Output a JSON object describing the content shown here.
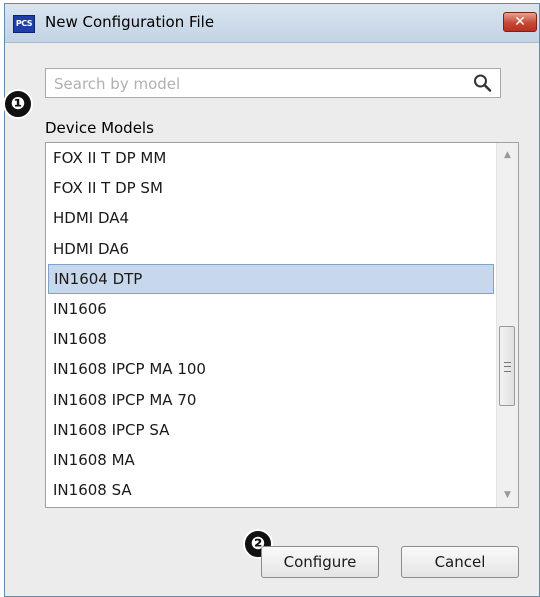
{
  "window": {
    "title": "New Configuration File",
    "app_icon_text": "PCS",
    "close_glyph": "✕"
  },
  "search": {
    "value": "",
    "placeholder": "Search by model",
    "icon": "search-icon"
  },
  "callouts": [
    "❶",
    "❷"
  ],
  "device_models": {
    "label": "Device Models",
    "items": [
      "FOX II T DP MM",
      "FOX II T DP SM",
      "HDMI DA4",
      "HDMI DA6",
      "IN1604 DTP",
      "IN1606",
      "IN1608",
      "IN1608 IPCP MA 100",
      "IN1608 IPCP MA 70",
      "IN1608 IPCP SA",
      "IN1608 MA",
      "IN1608 SA"
    ],
    "selected": "IN1604 DTP",
    "scroll_position": 0.5
  },
  "buttons": {
    "configure_label": "Configure",
    "cancel_label": "Cancel"
  },
  "colors": {
    "selection": "#c8d8ec",
    "close_button": "#c44a36",
    "app_icon": "#1f3fa8"
  }
}
